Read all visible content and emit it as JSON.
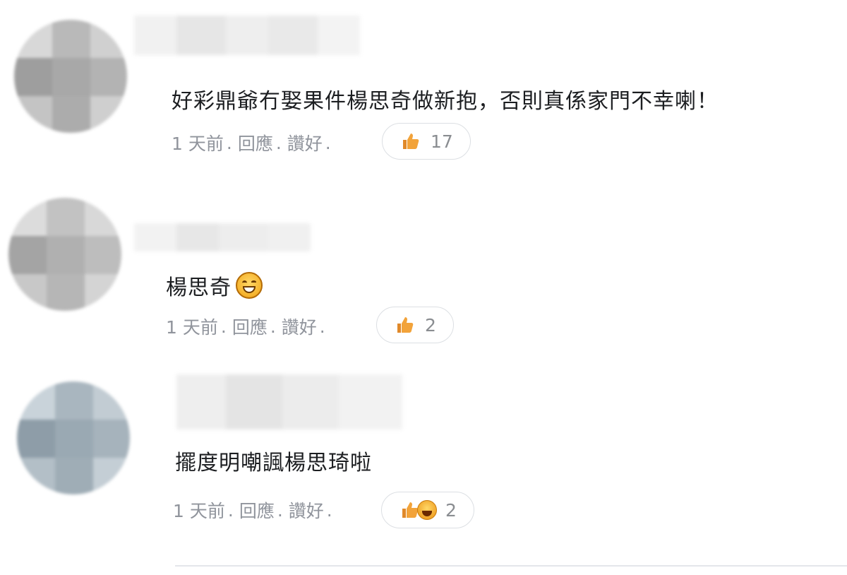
{
  "comments": [
    {
      "text": "好彩鼎爺冇娶果件楊思奇做新抱，否則真係家門不幸喇！",
      "time": "1 天前",
      "reply_label": "回應",
      "like_label": "讚好",
      "reaction_count": "17",
      "reactions": [
        "thumbs-up"
      ]
    },
    {
      "text": "楊思奇",
      "emoji": "grinning-sweat-emoji",
      "time": "1 天前",
      "reply_label": "回應",
      "like_label": "讚好",
      "reaction_count": "2",
      "reactions": [
        "thumbs-up"
      ]
    },
    {
      "text": "擺度明嘲諷楊思琦啦",
      "time": "1 天前",
      "reply_label": "回應",
      "like_label": "讚好",
      "reaction_count": "2",
      "reactions": [
        "thumbs-up",
        "haha"
      ]
    }
  ],
  "separator": ".",
  "colors": {
    "meta_text": "#90949c",
    "pill_border": "#dcdfe3",
    "thumb": "#f0a23a"
  }
}
